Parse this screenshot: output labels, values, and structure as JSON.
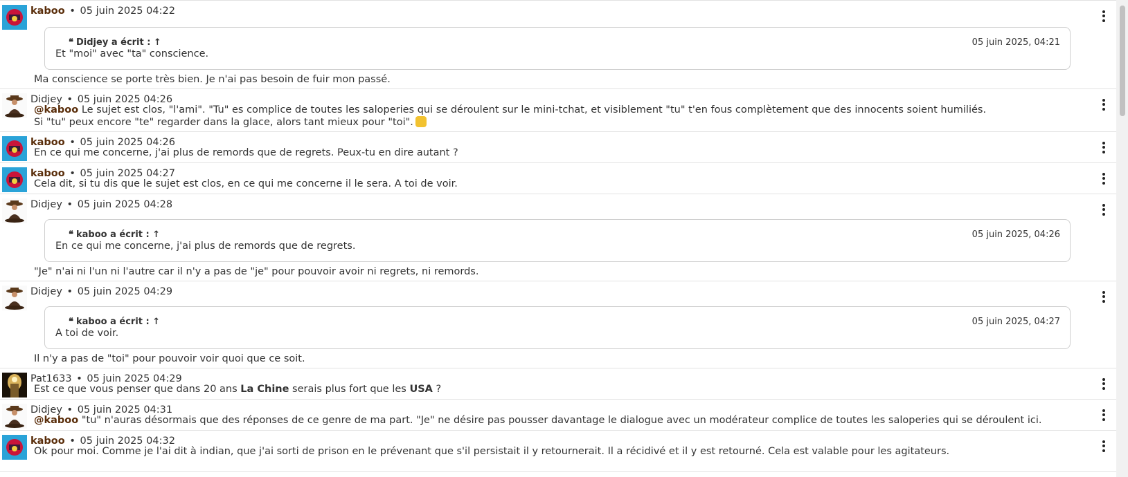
{
  "messages": [
    {
      "author": "kaboo",
      "time": "05 juin 2025 04:22",
      "quote": {
        "head": "Didjey a écrit : ↑",
        "date": "05 juin 2025, 04:21",
        "text": "Et \"moi\" avec \"ta\" conscience."
      },
      "body": "Ma conscience se porte très bien. Je n'ai pas besoin de fuir mon passé."
    },
    {
      "author": "Didjey",
      "time": "05 juin 2025 04:26",
      "mention": "@kaboo",
      "body": " Le sujet est clos, \"l'ami\". \"Tu\" es complice de toutes les saloperies qui se déroulent sur le mini-tchat, et visiblement \"tu\" t'en fous complètement que des innocents soient humiliés.",
      "body2": "Si \"tu\" peux encore \"te\" regarder dans la glace, alors tant mieux pour \"toi\"."
    },
    {
      "author": "kaboo",
      "time": "05 juin 2025 04:26",
      "body": "En ce qui me concerne, j'ai plus de remords que de regrets. Peux-tu en dire autant ?"
    },
    {
      "author": "kaboo",
      "time": "05 juin 2025 04:27",
      "body": "Cela dit, si tu dis que le sujet est clos, en ce qui me concerne il le sera. A toi de voir."
    },
    {
      "author": "Didjey",
      "time": "05 juin 2025 04:28",
      "quote": {
        "head": "kaboo a écrit : ↑",
        "date": "05 juin 2025, 04:26",
        "text": "En ce qui me concerne, j'ai plus de remords que de regrets."
      },
      "body": "\"Je\" n'ai ni l'un ni l'autre car il n'y a pas de \"je\" pour pouvoir avoir ni regrets, ni remords."
    },
    {
      "author": "Didjey",
      "time": "05 juin 2025 04:29",
      "quote": {
        "head": "kaboo a écrit : ↑",
        "date": "05 juin 2025, 04:27",
        "text": "A toi de voir."
      },
      "body": "Il n'y a pas de \"toi\" pour pouvoir voir quoi que ce soit."
    },
    {
      "author": "Pat1633",
      "time": "05 juin 2025 04:29",
      "body_a": "Est ce que vous penser que dans 20 ans ",
      "bold_a": "La Chine",
      "body_b": " serais plus fort que les ",
      "bold_b": "USA",
      "body_c": " ?"
    },
    {
      "author": "Didjey",
      "time": "05 juin 2025 04:31",
      "mention": "@kaboo",
      "body": " \"tu\" n'auras désormais que des réponses de ce genre de ma part. \"Je\" ne désire pas pousser davantage le dialogue avec un modérateur complice de toutes les saloperies qui se déroulent ici."
    },
    {
      "author": "kaboo",
      "time": "05 juin 2025 04:32",
      "body": "Ok pour moi. Comme je l'ai dit à indian, que j'ai sorti de prison en le prévenant que s'il persistait il y retournerait. Il a récidivé et il y est retourné. Cela est valable pour les agitateurs."
    }
  ],
  "separator": "•",
  "icons": {
    "menu": "vertical-ellipsis-icon",
    "quote": "quote-icon",
    "emoji": "thumbs-up-emoji"
  },
  "colors": {
    "moderator": "#5a2e0b"
  }
}
